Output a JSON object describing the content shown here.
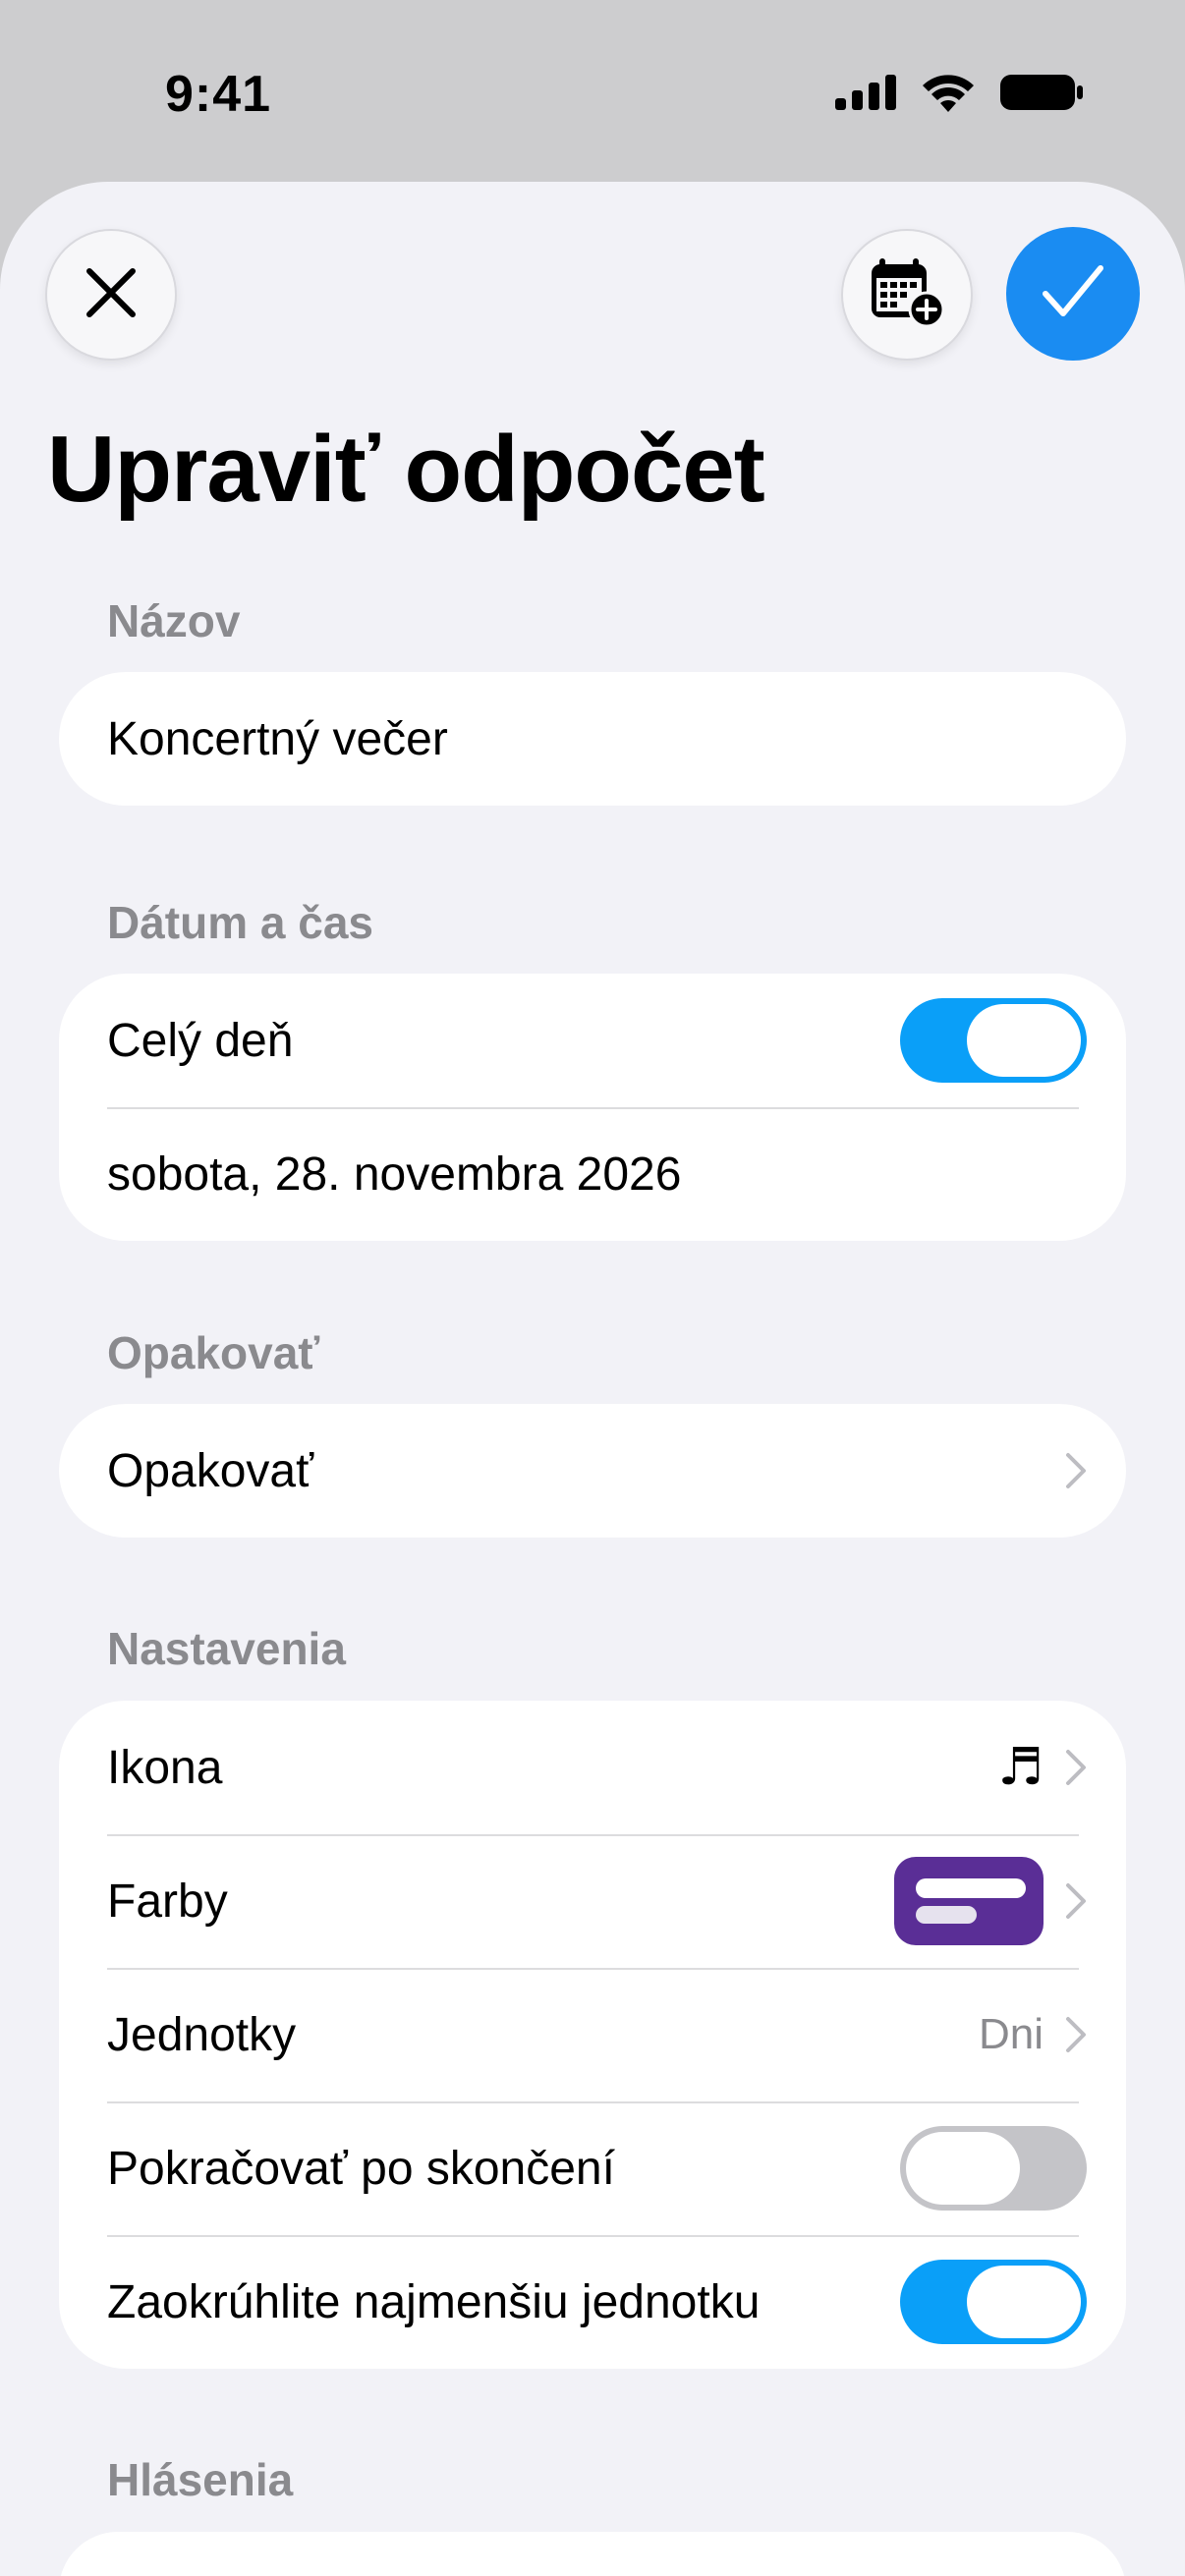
{
  "status_bar": {
    "time": "9:41"
  },
  "header": {
    "close_icon": "close-icon",
    "calendar_icon": "calendar-add-icon",
    "confirm_icon": "checkmark-icon",
    "title": "Upraviť odpočet"
  },
  "sections": {
    "name": {
      "label": "Názov",
      "value": "Koncertný večer"
    },
    "datetime": {
      "label": "Dátum a čas",
      "all_day_label": "Celý deň",
      "all_day_on": true,
      "date_value": "sobota, 28. novembra 2026"
    },
    "repeat": {
      "label": "Opakovať",
      "row_label": "Opakovať"
    },
    "settings": {
      "label": "Nastavenia",
      "icon_label": "Ikona",
      "icon_value": "♬",
      "colors_label": "Farby",
      "colors_value": "#5a2e96",
      "units_label": "Jednotky",
      "units_value": "Dni",
      "continue_label": "Pokračovať po skončení",
      "continue_on": false,
      "round_label": "Zaokrúhlite najmenšiu jednotku",
      "round_on": true
    },
    "notifications": {
      "label": "Hlásenia"
    }
  },
  "colors": {
    "accent": "#1a8cf2",
    "toggle_on": "#0a9ff8",
    "background": "#f2f2f7"
  }
}
